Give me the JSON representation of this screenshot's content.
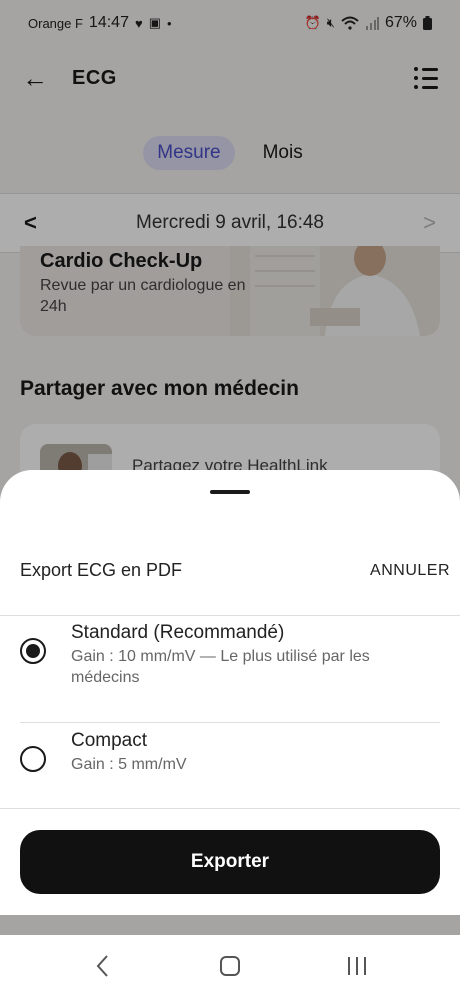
{
  "status_bar": {
    "carrier": "Orange F",
    "time": "14:47",
    "battery": "67%"
  },
  "header": {
    "title": "ECG"
  },
  "tabs": [
    {
      "label": "Mesure",
      "active": true
    },
    {
      "label": "Mois",
      "active": false
    }
  ],
  "date_bar": {
    "date": "Mercredi 9 avril, 16:48"
  },
  "promo": {
    "title": "Cardio Check-Up",
    "subtitle": "Revue par un cardiologue en 24h"
  },
  "share_section": {
    "title": "Partager avec mon médecin",
    "card_text": "Partagez votre HealthLink"
  },
  "sheet": {
    "title": "Export ECG en PDF",
    "cancel_label": "ANNULER",
    "options": [
      {
        "title": "Standard (Recommandé)",
        "description": "Gain : 10 mm/mV — Le plus utilisé par les médecins",
        "selected": true
      },
      {
        "title": "Compact",
        "description": "Gain : 5 mm/mV",
        "selected": false
      }
    ],
    "export_label": "Exporter"
  },
  "colors": {
    "accent": "#4a4fc8",
    "tab_active_bg": "#dcdcf3",
    "button_bg": "#111111"
  }
}
